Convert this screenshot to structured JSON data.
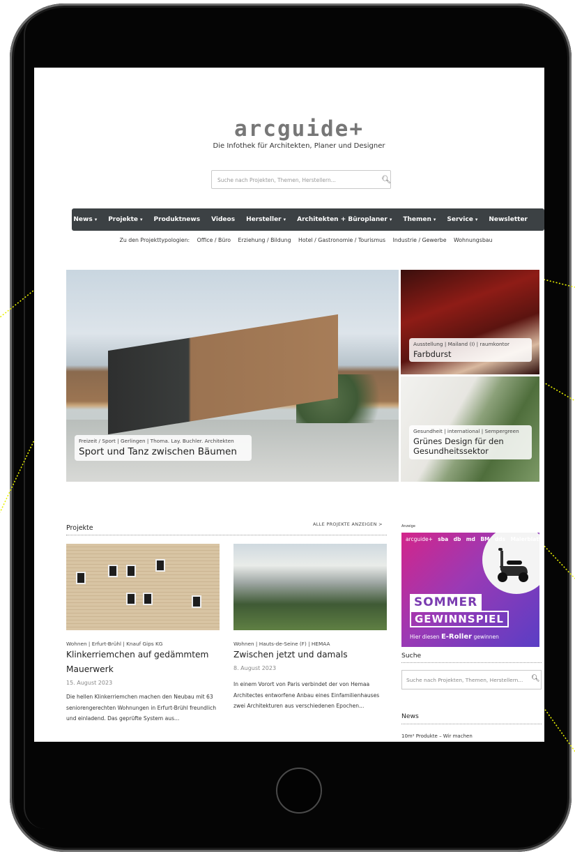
{
  "site": {
    "logo_main": "arcguide",
    "logo_plus": "+",
    "tagline": "Die Infothek für Architekten, Planer und Designer",
    "search_placeholder": "Suche nach Projekten, Themen, Herstellern..."
  },
  "nav": {
    "items": [
      {
        "label": "News",
        "dropdown": true
      },
      {
        "label": "Projekte",
        "dropdown": true
      },
      {
        "label": "Produktnews",
        "dropdown": false
      },
      {
        "label": "Videos",
        "dropdown": false
      },
      {
        "label": "Hersteller",
        "dropdown": true
      },
      {
        "label": "Architekten + Büroplaner",
        "dropdown": true
      },
      {
        "label": "Themen",
        "dropdown": true
      },
      {
        "label": "Service",
        "dropdown": true
      },
      {
        "label": "Newsletter",
        "dropdown": false
      }
    ],
    "caret": "▾"
  },
  "subnav": {
    "intro": "Zu den Projekttypologien:",
    "items": [
      "Office / Büro",
      "Erziehung / Bildung",
      "Hotel / Gastronomie / Tourismus",
      "Industrie / Gewerbe",
      "Wohnungsbau"
    ]
  },
  "hero": {
    "meta": "Freizeit / Sport | Gerlingen | Thoma. Lay. Buchler. Architekten",
    "title": "Sport und Tanz zwischen Bäumen"
  },
  "side_teasers": [
    {
      "meta": "Ausstellung | Mailand (I) | raumkontor",
      "title": "Farbdurst"
    },
    {
      "meta": "Gesundheit | international | Sempergreen",
      "title": "Grünes Design für den Gesundheitssektor"
    }
  ],
  "projects": {
    "title": "Projekte",
    "all_link": "ALLE PROJEKTE ANZEIGEN  >",
    "cards": [
      {
        "meta": "Wohnen | Erfurt-Brühl | Knauf Gips KG",
        "title": "Klinkerriemchen auf gedämmtem Mauerwerk",
        "date": "15. August 2023",
        "text": "Die hellen Klinkerriemchen machen den Neubau mit 63 seniorengerechten Wohnungen in Erfurt-Brühl freundlich und einladend. Das geprüfte System aus..."
      },
      {
        "meta": "Wohnen | Hauts-de-Seine (F) | HEMAA",
        "title": "Zwischen jetzt und damals",
        "date": "8. August 2023",
        "text": "In einem Vorort von Paris verbindet der von Hemaa Architectes entworfene Anbau eines Einfamilienhauses zwei Architekturen aus verschiedenen Epochen..."
      }
    ]
  },
  "sidebar": {
    "ad_label": "Anzeige",
    "ad_brands": [
      "arcguide+",
      "sba",
      "db",
      "md",
      "BM",
      "dds",
      "Malerblatt"
    ],
    "ad_line1": "SOMMER",
    "ad_line2": "GEWINNSPIEL",
    "ad_sub_pre": "Hier diesen ",
    "ad_sub_bold": "E-Roller",
    "ad_sub_post": " gewinnen",
    "search_title": "Suche",
    "search_placeholder": "Suche nach Projekten, Themen, Herstellern...",
    "news_title": "News",
    "news_teaser": "10m² Produkte – Wir machen"
  },
  "colors": {
    "nav_bg": "#3c4144",
    "pointer_line": "#e8f000"
  }
}
